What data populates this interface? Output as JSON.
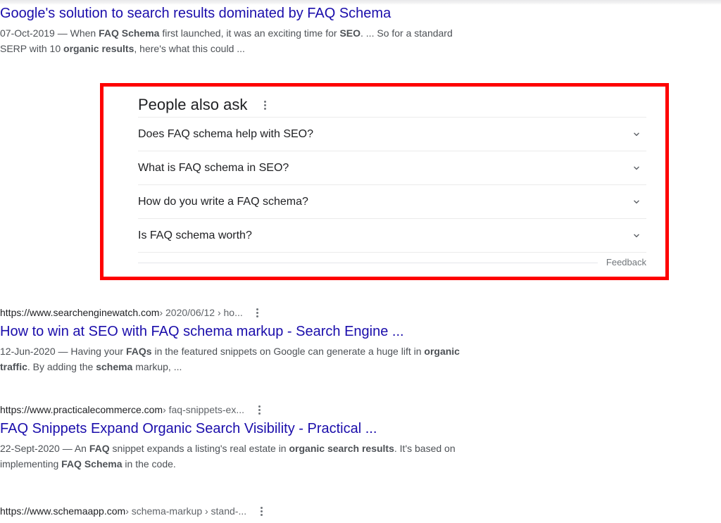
{
  "page": {
    "engine": "google-search-results"
  },
  "results_top": {
    "title": "Google's solution to search results dominated by FAQ Schema",
    "snippet_date": "07-Oct-2019",
    "snippet_parts": [
      {
        "text": "07-Oct-2019 — When ",
        "bold": false
      },
      {
        "text": "FAQ Schema",
        "bold": true
      },
      {
        "text": " first launched, it was an exciting time for ",
        "bold": false
      },
      {
        "text": "SEO",
        "bold": true
      },
      {
        "text": ". ... So for a standard SERP with 10 ",
        "bold": false
      },
      {
        "text": "organic results",
        "bold": true
      },
      {
        "text": ", here's what this could ...",
        "bold": false
      }
    ]
  },
  "people_also_ask": {
    "title": "People also ask",
    "menu_icon": "kebab-menu-icon",
    "questions": [
      {
        "text": "Does FAQ schema help with SEO?",
        "icon": "chevron-down-icon"
      },
      {
        "text": "What is FAQ schema in SEO?",
        "icon": "chevron-down-icon"
      },
      {
        "text": "How do you write a FAQ schema?",
        "icon": "chevron-down-icon"
      },
      {
        "text": "Is FAQ schema worth?",
        "icon": "chevron-down-icon"
      }
    ],
    "feedback_label": "Feedback",
    "highlight_color": "#fe0000"
  },
  "results": [
    {
      "url_domain": "https://www.searchenginewatch.com",
      "url_path": " › 2020/06/12 › ho...",
      "menu_icon": "kebab-menu-icon",
      "title": "How to win at SEO with FAQ schema markup - Search Engine ...",
      "snippet_parts": [
        {
          "text": "12-Jun-2020 — Having your ",
          "bold": false
        },
        {
          "text": "FAQs",
          "bold": true
        },
        {
          "text": " in the featured snippets on Google can generate a huge lift in ",
          "bold": false
        },
        {
          "text": "organic traffic",
          "bold": true
        },
        {
          "text": ". By adding the ",
          "bold": false
        },
        {
          "text": "schema",
          "bold": true
        },
        {
          "text": " markup, ...",
          "bold": false
        }
      ]
    },
    {
      "url_domain": "https://www.practicalecommerce.com",
      "url_path": " › faq-snippets-ex...",
      "menu_icon": "kebab-menu-icon",
      "title": "FAQ Snippets Expand Organic Search Visibility - Practical ...",
      "snippet_parts": [
        {
          "text": "22-Sept-2020 — An ",
          "bold": false
        },
        {
          "text": "FAQ",
          "bold": true
        },
        {
          "text": " snippet expands a listing's real estate in ",
          "bold": false
        },
        {
          "text": "organic search results",
          "bold": true
        },
        {
          "text": ". It's based on implementing ",
          "bold": false
        },
        {
          "text": "FAQ Schema",
          "bold": true
        },
        {
          "text": " in the code.",
          "bold": false
        }
      ]
    },
    {
      "url_domain": "https://www.schemaapp.com",
      "url_path": " › schema-markup › stand-...",
      "menu_icon": "kebab-menu-icon",
      "title": "",
      "snippet_parts": []
    }
  ],
  "colors": {
    "link": "#1a0dab",
    "snippet_text": "#4d5156",
    "url_domain": "#202124",
    "url_path": "#5f6368",
    "highlight": "#fe0000"
  }
}
